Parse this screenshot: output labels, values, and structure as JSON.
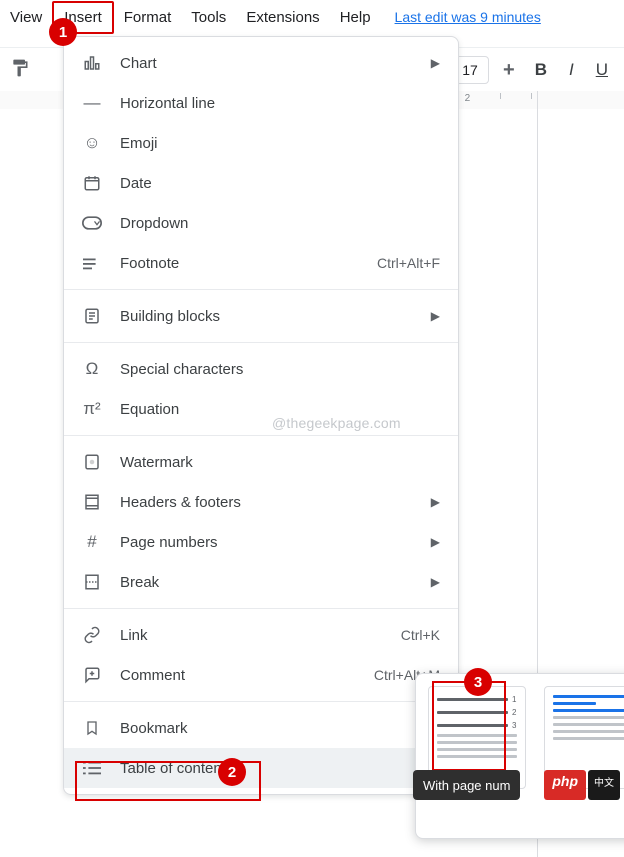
{
  "menubar": {
    "view": "View",
    "insert": "Insert",
    "format": "Format",
    "tools": "Tools",
    "extensions": "Extensions",
    "help": "Help",
    "last_edit": "Last edit was 9 minutes"
  },
  "toolbar": {
    "font_size": "17",
    "bold": "B",
    "italic": "I",
    "underline": "U"
  },
  "ruler": {
    "mark": "2"
  },
  "callouts": {
    "one": "1",
    "two": "2",
    "three": "3"
  },
  "menu": {
    "chart": "Chart",
    "hr": "Horizontal line",
    "emoji": "Emoji",
    "date": "Date",
    "dropdown": "Dropdown",
    "footnote": "Footnote",
    "footnote_sc": "Ctrl+Alt+F",
    "building_blocks": "Building blocks",
    "special": "Special characters",
    "equation": "Equation",
    "watermark_item": "Watermark",
    "headers": "Headers & footers",
    "page_numbers": "Page numbers",
    "break": "Break",
    "link": "Link",
    "link_sc": "Ctrl+K",
    "comment": "Comment",
    "comment_sc": "Ctrl+Alt+M",
    "bookmark": "Bookmark",
    "toc": "Table of contents",
    "watermark_text": "@thegeekpage.com"
  },
  "submenu": {
    "tooltip": "With page num",
    "n1": "1",
    "n2": "2",
    "n3": "3"
  },
  "badges": {
    "php": "php",
    "cn": "中文"
  }
}
